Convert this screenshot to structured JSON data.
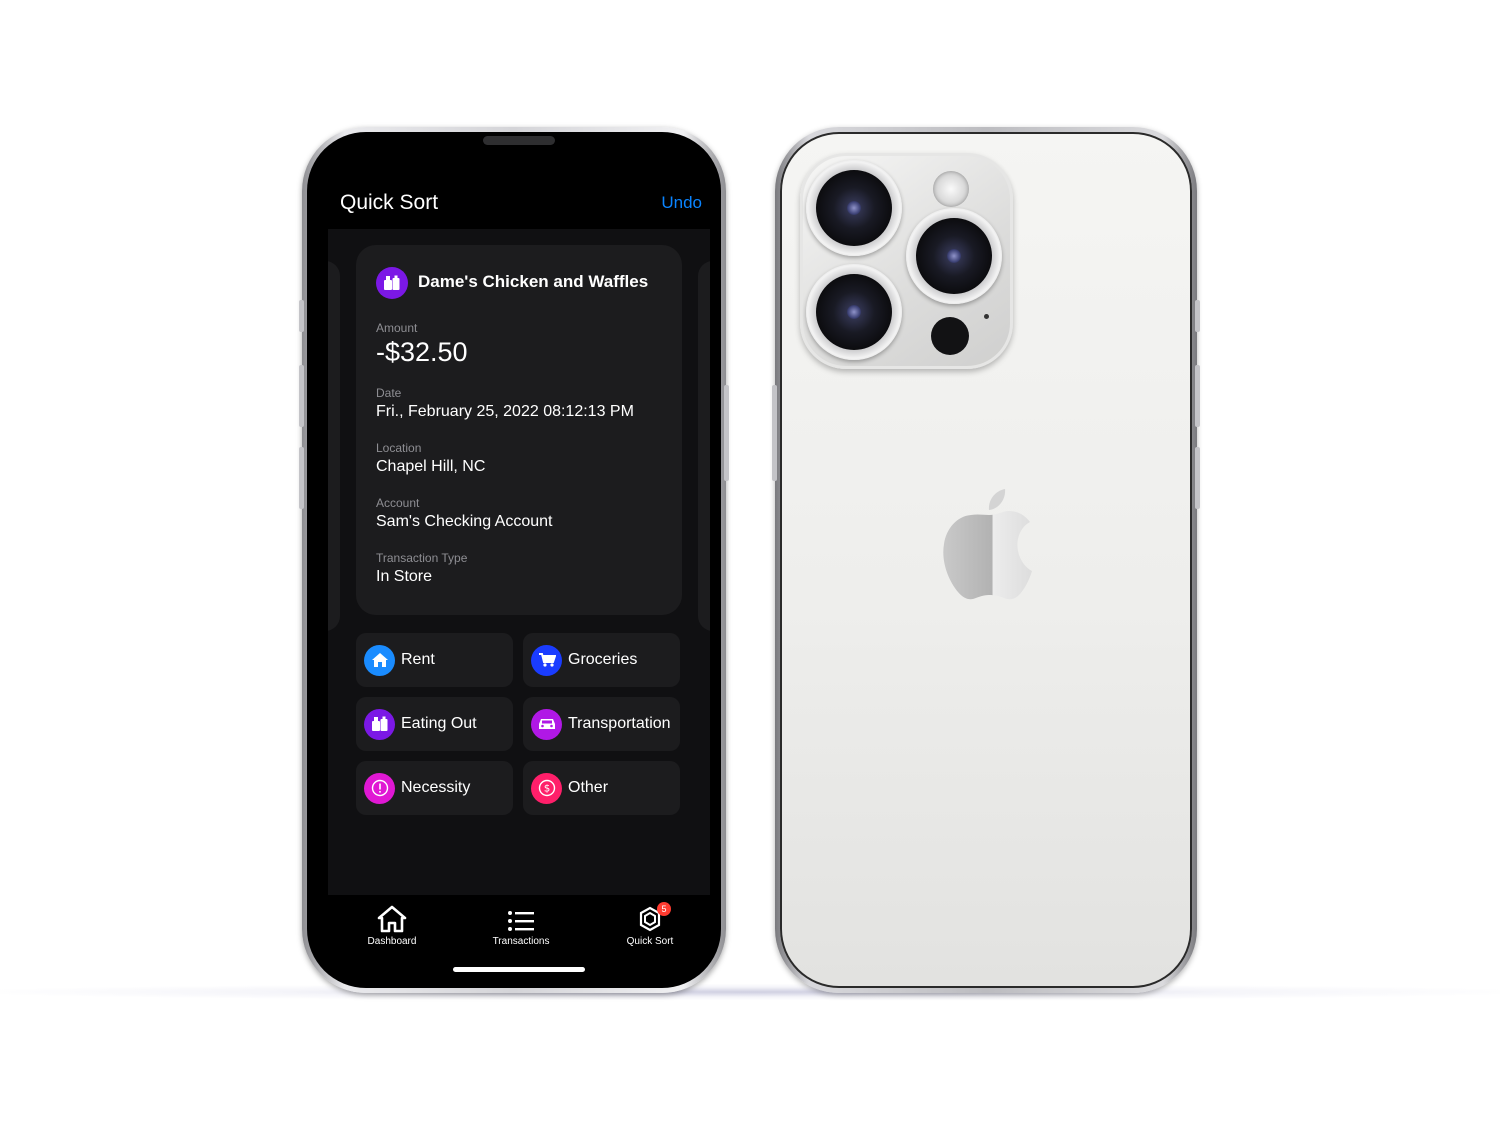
{
  "nav": {
    "title": "Quick Sort",
    "undo_label": "Undo"
  },
  "transaction": {
    "merchant": "Dame's Chicken and Waffles",
    "amount_label": "Amount",
    "amount": "-$32.50",
    "date_label": "Date",
    "date": "Fri., February 25, 2022 08:12:13 PM",
    "location_label": "Location",
    "location": "Chapel Hill, NC",
    "account_label": "Account",
    "account": "Sam's Checking Account",
    "type_label": "Transaction Type",
    "type": "In Store"
  },
  "categories": [
    {
      "label": "Rent",
      "icon": "house-icon",
      "color": "#1a8cff"
    },
    {
      "label": "Groceries",
      "icon": "cart-icon",
      "color": "#1a3cff"
    },
    {
      "label": "Eating Out",
      "icon": "takeout-icon",
      "color": "#7b18e6"
    },
    {
      "label": "Transportation",
      "icon": "car-icon",
      "color": "#b018e6"
    },
    {
      "label": "Necessity",
      "icon": "exclamation-icon",
      "color": "#e018d4"
    },
    {
      "label": "Other",
      "icon": "dollar-icon",
      "color": "#ff1f6a"
    }
  ],
  "tabbar": {
    "tabs": [
      {
        "label": "Dashboard",
        "icon": "house-icon"
      },
      {
        "label": "Transactions",
        "icon": "list-icon"
      },
      {
        "label": "Quick Sort",
        "icon": "sort-icon",
        "badge": "5"
      }
    ]
  },
  "colors": {
    "accent": "#0a84ff",
    "card": "#1c1c1e",
    "badge": "#ff3b30"
  }
}
